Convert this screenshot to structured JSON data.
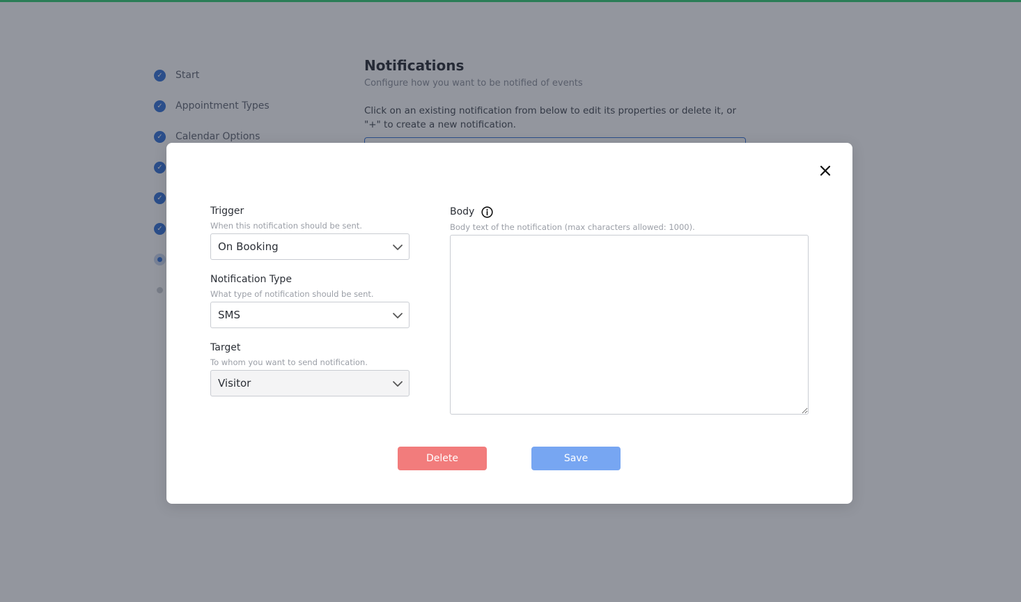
{
  "colors": {
    "top_bar": "#2ecc71",
    "accent": "#2f6fd6",
    "delete": "#f27c7c",
    "save": "#77a6f2"
  },
  "steps": [
    {
      "label": "Start",
      "state": "done",
      "icon": "check-icon"
    },
    {
      "label": "Appointment Types",
      "state": "done",
      "icon": "check-icon"
    },
    {
      "label": "Calendar Options",
      "state": "done",
      "icon": "check-icon"
    },
    {
      "label": "",
      "state": "done",
      "icon": "check-icon"
    },
    {
      "label": "",
      "state": "done",
      "icon": "check-icon"
    },
    {
      "label": "",
      "state": "done",
      "icon": "check-icon"
    },
    {
      "label": "",
      "state": "current",
      "icon": "current-dot-icon"
    },
    {
      "label": "",
      "state": "pending",
      "icon": "pending-dot-icon"
    }
  ],
  "main": {
    "title": "Notifications",
    "subtitle": "Configure how you want to be notified of events",
    "instructions": "Click on an existing notification from below to edit its properties or delete it, or \"+\" to create a new notification."
  },
  "modal": {
    "close_icon": "close-icon",
    "trigger": {
      "label": "Trigger",
      "help": "When this notification should be sent.",
      "value": "On Booking"
    },
    "notification_type": {
      "label": "Notification Type",
      "help": "What type of notification should be sent.",
      "value": "SMS"
    },
    "target": {
      "label": "Target",
      "help": "To whom you want to send notification.",
      "value": "Visitor"
    },
    "body": {
      "label": "Body",
      "info_icon": "info-icon",
      "help": "Body text of the notification (max characters allowed: 1000).",
      "value": ""
    },
    "delete_label": "Delete",
    "save_label": "Save"
  }
}
